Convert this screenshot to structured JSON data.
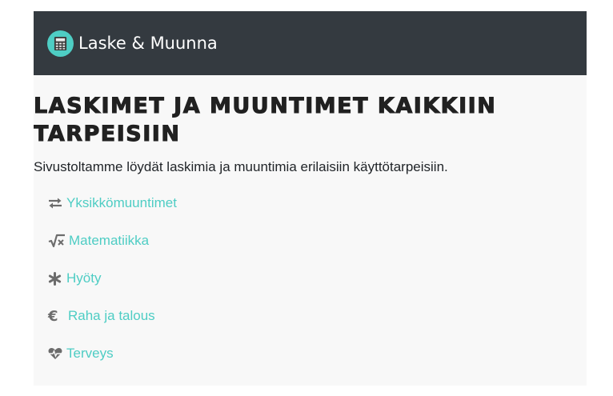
{
  "navbar": {
    "brand": "Laske & Muunna",
    "brand_icon": "calculator-icon",
    "background": "#343a40",
    "accent": "#4ecdc4"
  },
  "main": {
    "heading": "Laskimet ja muuntimet kaikkiin tarpeisiin",
    "intro": "Sivustoltamme löydät laskimia ja muuntimia erilaisiin käyttötarpeisiin.",
    "categories": [
      {
        "label": "Yksikkömuuntimet",
        "icon": "exchange-arrows-icon"
      },
      {
        "label": "Matematiikka",
        "icon": "square-root-icon"
      },
      {
        "label": "Hyöty",
        "icon": "asterisk-icon"
      },
      {
        "label": "Raha ja talous",
        "icon": "euro-icon"
      },
      {
        "label": "Terveys",
        "icon": "heartbeat-icon"
      }
    ]
  }
}
